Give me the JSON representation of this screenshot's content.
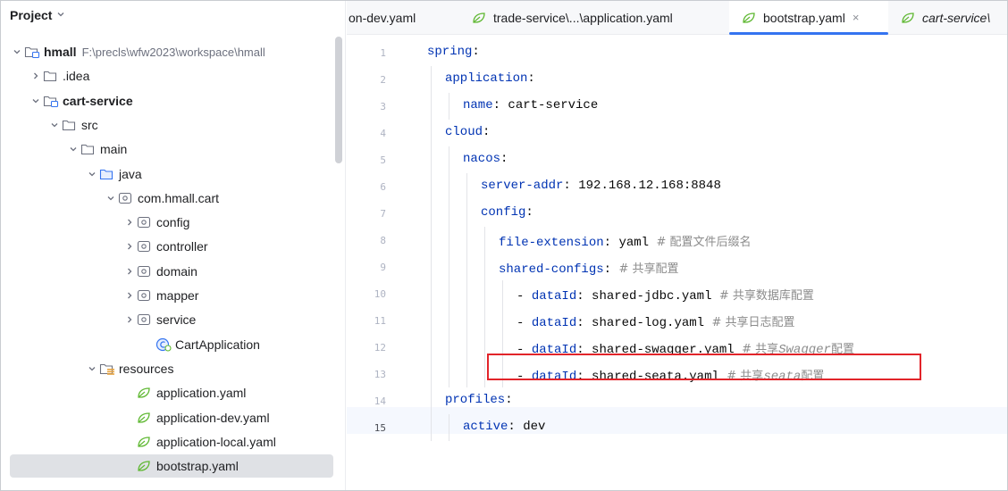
{
  "project_panel": {
    "title": "Project",
    "tree": [
      {
        "label": "hmall",
        "path": "F:\\precls\\wfw2023\\workspace\\hmall",
        "bold": true,
        "icon": "module-folder-icon",
        "chev": "down",
        "depth": 0
      },
      {
        "label": ".idea",
        "bold": false,
        "icon": "folder-icon",
        "chev": "right",
        "depth": 1
      },
      {
        "label": "cart-service",
        "bold": true,
        "icon": "module-folder-icon",
        "chev": "down",
        "depth": 1
      },
      {
        "label": "src",
        "bold": false,
        "icon": "folder-icon",
        "chev": "down",
        "depth": 2
      },
      {
        "label": "main",
        "bold": false,
        "icon": "folder-icon",
        "chev": "down",
        "depth": 3
      },
      {
        "label": "java",
        "bold": false,
        "icon": "source-folder-icon",
        "chev": "down",
        "depth": 4
      },
      {
        "label": "com.hmall.cart",
        "bold": false,
        "icon": "package-icon",
        "chev": "down",
        "depth": 5
      },
      {
        "label": "config",
        "bold": false,
        "icon": "package-icon",
        "chev": "right",
        "depth": 6
      },
      {
        "label": "controller",
        "bold": false,
        "icon": "package-icon",
        "chev": "right",
        "depth": 6
      },
      {
        "label": "domain",
        "bold": false,
        "icon": "package-icon",
        "chev": "right",
        "depth": 6
      },
      {
        "label": "mapper",
        "bold": false,
        "icon": "package-icon",
        "chev": "right",
        "depth": 6
      },
      {
        "label": "service",
        "bold": false,
        "icon": "package-icon",
        "chev": "right",
        "depth": 6
      },
      {
        "label": "CartApplication",
        "bold": false,
        "icon": "spring-boot-class-icon",
        "chev": "none",
        "depth": 7
      },
      {
        "label": "resources",
        "bold": false,
        "icon": "resources-folder-icon",
        "chev": "down",
        "depth": 4
      },
      {
        "label": "application.yaml",
        "bold": false,
        "icon": "spring-yaml-icon",
        "chev": "none",
        "depth": 6
      },
      {
        "label": "application-dev.yaml",
        "bold": false,
        "icon": "spring-yaml-icon",
        "chev": "none",
        "depth": 6
      },
      {
        "label": "application-local.yaml",
        "bold": false,
        "icon": "spring-yaml-icon",
        "chev": "none",
        "depth": 6
      },
      {
        "label": "bootstrap.yaml",
        "bold": false,
        "icon": "spring-yaml-icon",
        "chev": "none",
        "depth": 6,
        "selected": true
      }
    ]
  },
  "tabs": [
    {
      "label": "on-dev.yaml",
      "icon": "",
      "active": false
    },
    {
      "label": "trade-service\\...\\application.yaml",
      "icon": "spring-yaml-icon",
      "active": false
    },
    {
      "label": "bootstrap.yaml",
      "icon": "spring-yaml-icon",
      "active": true,
      "close": "×"
    },
    {
      "label": "cart-service\\",
      "icon": "spring-yaml-icon",
      "active": false,
      "italic": true
    }
  ],
  "editor": {
    "current_line": 15,
    "lines": [
      {
        "n": "1",
        "indent": 0,
        "key": "spring",
        "value": "",
        "comment": ""
      },
      {
        "n": "2",
        "indent": 1,
        "key": "application",
        "value": "",
        "comment": ""
      },
      {
        "n": "3",
        "indent": 2,
        "key": "name",
        "value": "cart-service",
        "comment": ""
      },
      {
        "n": "4",
        "indent": 1,
        "key": "cloud",
        "value": "",
        "comment": ""
      },
      {
        "n": "5",
        "indent": 2,
        "key": "nacos",
        "value": "",
        "comment": ""
      },
      {
        "n": "6",
        "indent": 3,
        "key": "server-addr",
        "value": "192.168.12.168:8848",
        "comment": ""
      },
      {
        "n": "7",
        "indent": 3,
        "key": "config",
        "value": "",
        "comment": ""
      },
      {
        "n": "8",
        "indent": 4,
        "key": "file-extension",
        "value": "yaml",
        "comment": "# 配置文件后缀名"
      },
      {
        "n": "9",
        "indent": 4,
        "key": "shared-configs",
        "value": "",
        "comment": "# 共享配置"
      },
      {
        "n": "10",
        "indent": 5,
        "dash": true,
        "key": "dataId",
        "value": "shared-jdbc.yaml",
        "comment": "# 共享数据库配置"
      },
      {
        "n": "11",
        "indent": 5,
        "dash": true,
        "key": "dataId",
        "value": "shared-log.yaml",
        "comment": "# 共享日志配置"
      },
      {
        "n": "12",
        "indent": 5,
        "dash": true,
        "key": "dataId",
        "value": "shared-swagger.yaml",
        "comment_pre": "# 共享",
        "comment_it": "Swagger",
        "comment_post": "配置"
      },
      {
        "n": "13",
        "indent": 5,
        "dash": true,
        "key": "dataId",
        "value": "shared-seata.yaml",
        "comment_pre": "# 共享",
        "comment_it": "seata",
        "comment_post": "配置"
      },
      {
        "n": "14",
        "indent": 1,
        "key": "profiles",
        "value": "",
        "comment": ""
      },
      {
        "n": "15",
        "indent": 2,
        "key": "active",
        "value": "dev",
        "comment": ""
      }
    ]
  },
  "colors": {
    "accent": "#3574f0",
    "highlight_box": "#e2242a",
    "yaml_key": "#0033b3",
    "comment": "#8c8c8c"
  }
}
